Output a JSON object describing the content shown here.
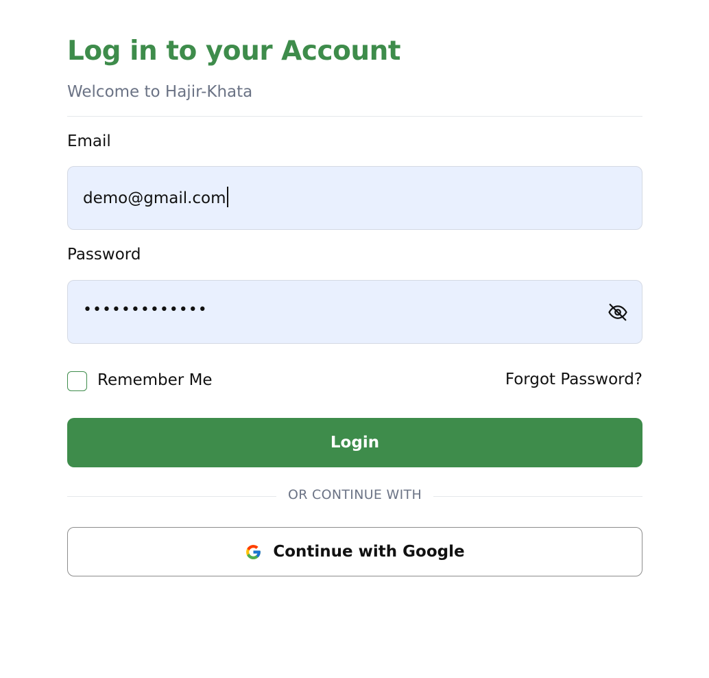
{
  "header": {
    "title": "Log in to your Account",
    "subtitle": "Welcome to Hajir-Khata"
  },
  "form": {
    "email_label": "Email",
    "email_value": "demo@gmail.com",
    "password_label": "Password",
    "password_value_masked": "•••••••••••••",
    "remember_label": "Remember Me",
    "remember_checked": false,
    "forgot_label": "Forgot Password?",
    "login_label": "Login"
  },
  "divider": {
    "text": "OR CONTINUE WITH"
  },
  "social": {
    "google_label": "Continue with Google"
  },
  "icons": {
    "password_toggle": "eye-off-icon",
    "google": "google-icon"
  },
  "colors": {
    "brand": "#3e8c4b",
    "input_bg": "#e9f0fe",
    "muted": "#6b7385"
  }
}
